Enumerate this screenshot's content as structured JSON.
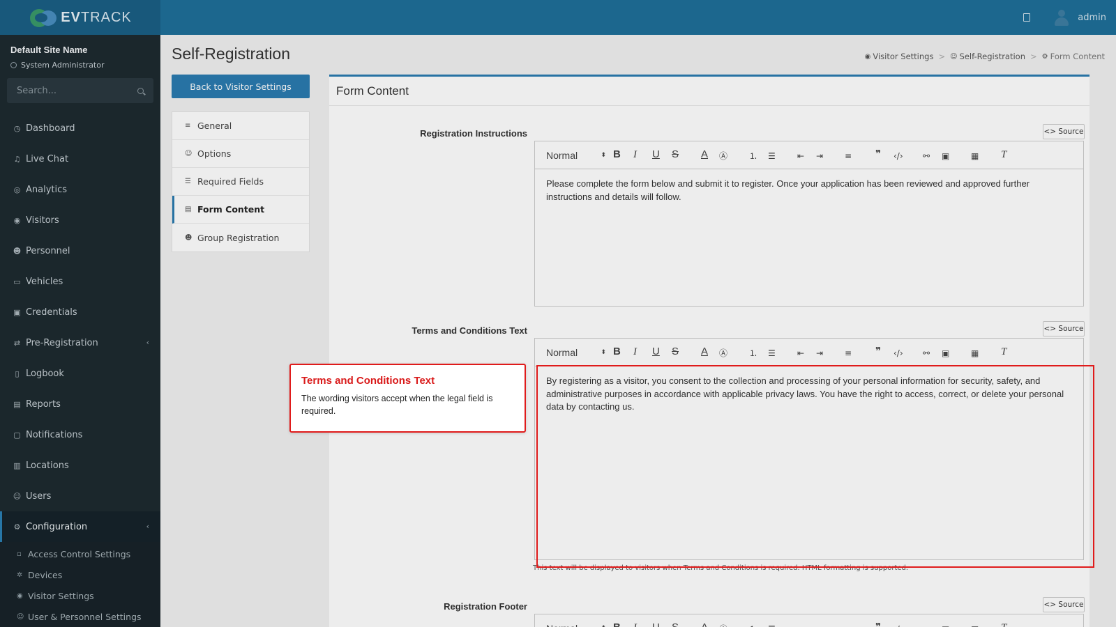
{
  "brand": {
    "logo_text_bold": "EV",
    "logo_text": "TRACK"
  },
  "topbar": {
    "user": "admin",
    "book_icon": "book-icon",
    "avatar_icon": "user-avatar-icon"
  },
  "sidebar": {
    "site_name": "Default Site Name",
    "role": "System Administrator",
    "search_placeholder": "Search...",
    "items": [
      {
        "label": "Dashboard",
        "icon": "dashboard-icon"
      },
      {
        "label": "Live Chat",
        "icon": "headset-icon"
      },
      {
        "label": "Analytics",
        "icon": "target-icon"
      },
      {
        "label": "Visitors",
        "icon": "eye-icon"
      },
      {
        "label": "Personnel",
        "icon": "users-icon"
      },
      {
        "label": "Vehicles",
        "icon": "car-icon"
      },
      {
        "label": "Credentials",
        "icon": "id-card-icon"
      },
      {
        "label": "Pre-Registration",
        "icon": "swap-icon",
        "chevron": "‹"
      },
      {
        "label": "Logbook",
        "icon": "book-icon"
      },
      {
        "label": "Reports",
        "icon": "report-icon"
      },
      {
        "label": "Notifications",
        "icon": "bell-icon"
      },
      {
        "label": "Locations",
        "icon": "building-icon"
      },
      {
        "label": "Users",
        "icon": "user-icon"
      },
      {
        "label": "Configuration",
        "icon": "gear-icon",
        "chevron": "‹",
        "active": true
      }
    ],
    "subitems": [
      {
        "label": "Access Control Settings",
        "icon": "lock-icon"
      },
      {
        "label": "Devices",
        "icon": "cog-icon"
      },
      {
        "label": "Visitor Settings",
        "icon": "eye-icon"
      },
      {
        "label": "User & Personnel Settings",
        "icon": "user-icon"
      }
    ]
  },
  "page": {
    "title": "Self-Registration"
  },
  "breadcrumb": [
    "Visitor Settings",
    "Self-Registration",
    "Form Content"
  ],
  "back_button": "Back to Visitor Settings",
  "tabs": [
    {
      "label": "General",
      "icon": "sliders-icon"
    },
    {
      "label": "Options",
      "icon": "user-gear-icon"
    },
    {
      "label": "Required Fields",
      "icon": "checklist-icon"
    },
    {
      "label": "Form Content",
      "icon": "document-icon",
      "active": true
    },
    {
      "label": "Group Registration",
      "icon": "group-icon"
    }
  ],
  "panel": {
    "title": "Form Content"
  },
  "editor_toolbar": {
    "format": "Normal",
    "source": "<> Source"
  },
  "fields": {
    "instructions": {
      "label": "Registration Instructions",
      "text": "Please complete the form below and submit it to register. Once your application has been reviewed and approved further instructions and details will follow."
    },
    "terms": {
      "label": "Terms and Conditions Text",
      "text": "By registering as a visitor, you consent to the collection and processing of your personal information for security, safety, and administrative purposes in accordance with applicable privacy laws. You have the right to access, correct, or delete your personal data by contacting us.",
      "hint": "This text will be displayed to visitors when Terms and Conditions is required. HTML formatting is supported."
    },
    "footer": {
      "label": "Registration Footer"
    }
  },
  "callout": {
    "title": "Terms and Conditions Text",
    "body": "The wording visitors accept when the legal field is required."
  },
  "colors": {
    "accent": "#2a7bb0",
    "topbar": "#1f6f99",
    "sidebar": "#1e2a30",
    "highlight": "#e01b1b"
  }
}
